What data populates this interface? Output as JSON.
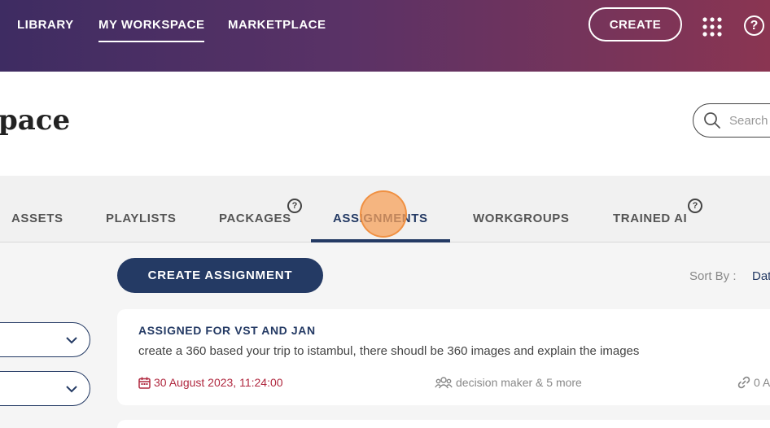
{
  "nav": {
    "items": [
      {
        "label": "LIBRARY"
      },
      {
        "label": "MY WORKSPACE"
      },
      {
        "label": "MARKETPLACE"
      }
    ],
    "create_label": "CREATE",
    "help_label": "?"
  },
  "header": {
    "title": "pace",
    "search_placeholder": "Search"
  },
  "tabs": [
    {
      "label": "ASSETS"
    },
    {
      "label": "PLAYLISTS"
    },
    {
      "label": "PACKAGES"
    },
    {
      "label": "ASSIGNMENTS"
    },
    {
      "label": "WORKGROUPS"
    },
    {
      "label": "TRAINED AI"
    }
  ],
  "tab_help": "?",
  "toolbar": {
    "create_assignment_label": "CREATE ASSIGNMENT",
    "sort_label": "Sort By :",
    "sort_value": "Dat"
  },
  "assignments": [
    {
      "title": "ASSIGNED FOR VST AND JAN",
      "description": "create a 360 based your trip to istambul, there shoudl be 360 images and explain the images",
      "date": "30 August 2023, 11:24:00",
      "group": "decision maker & 5 more",
      "links": "0 A"
    }
  ],
  "colors": {
    "accent": "#243a64",
    "date": "#b0283f"
  }
}
